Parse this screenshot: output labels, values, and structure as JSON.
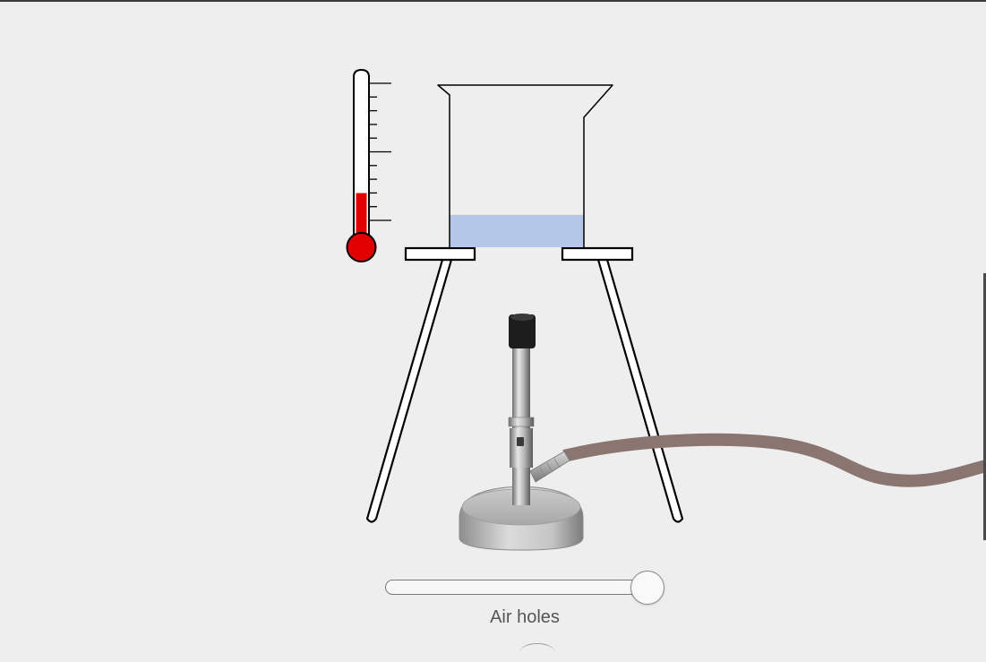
{
  "controls": {
    "air_holes": {
      "label": "Air holes",
      "value": 1.0,
      "min": 0,
      "max": 1
    }
  },
  "thermometer": {
    "fill_fraction": 0.3,
    "liquid_color": "#e30000"
  },
  "beaker": {
    "water_fill_fraction": 0.2,
    "water_color": "#b4c7e8"
  },
  "gas_hose_color": "#8a7570"
}
